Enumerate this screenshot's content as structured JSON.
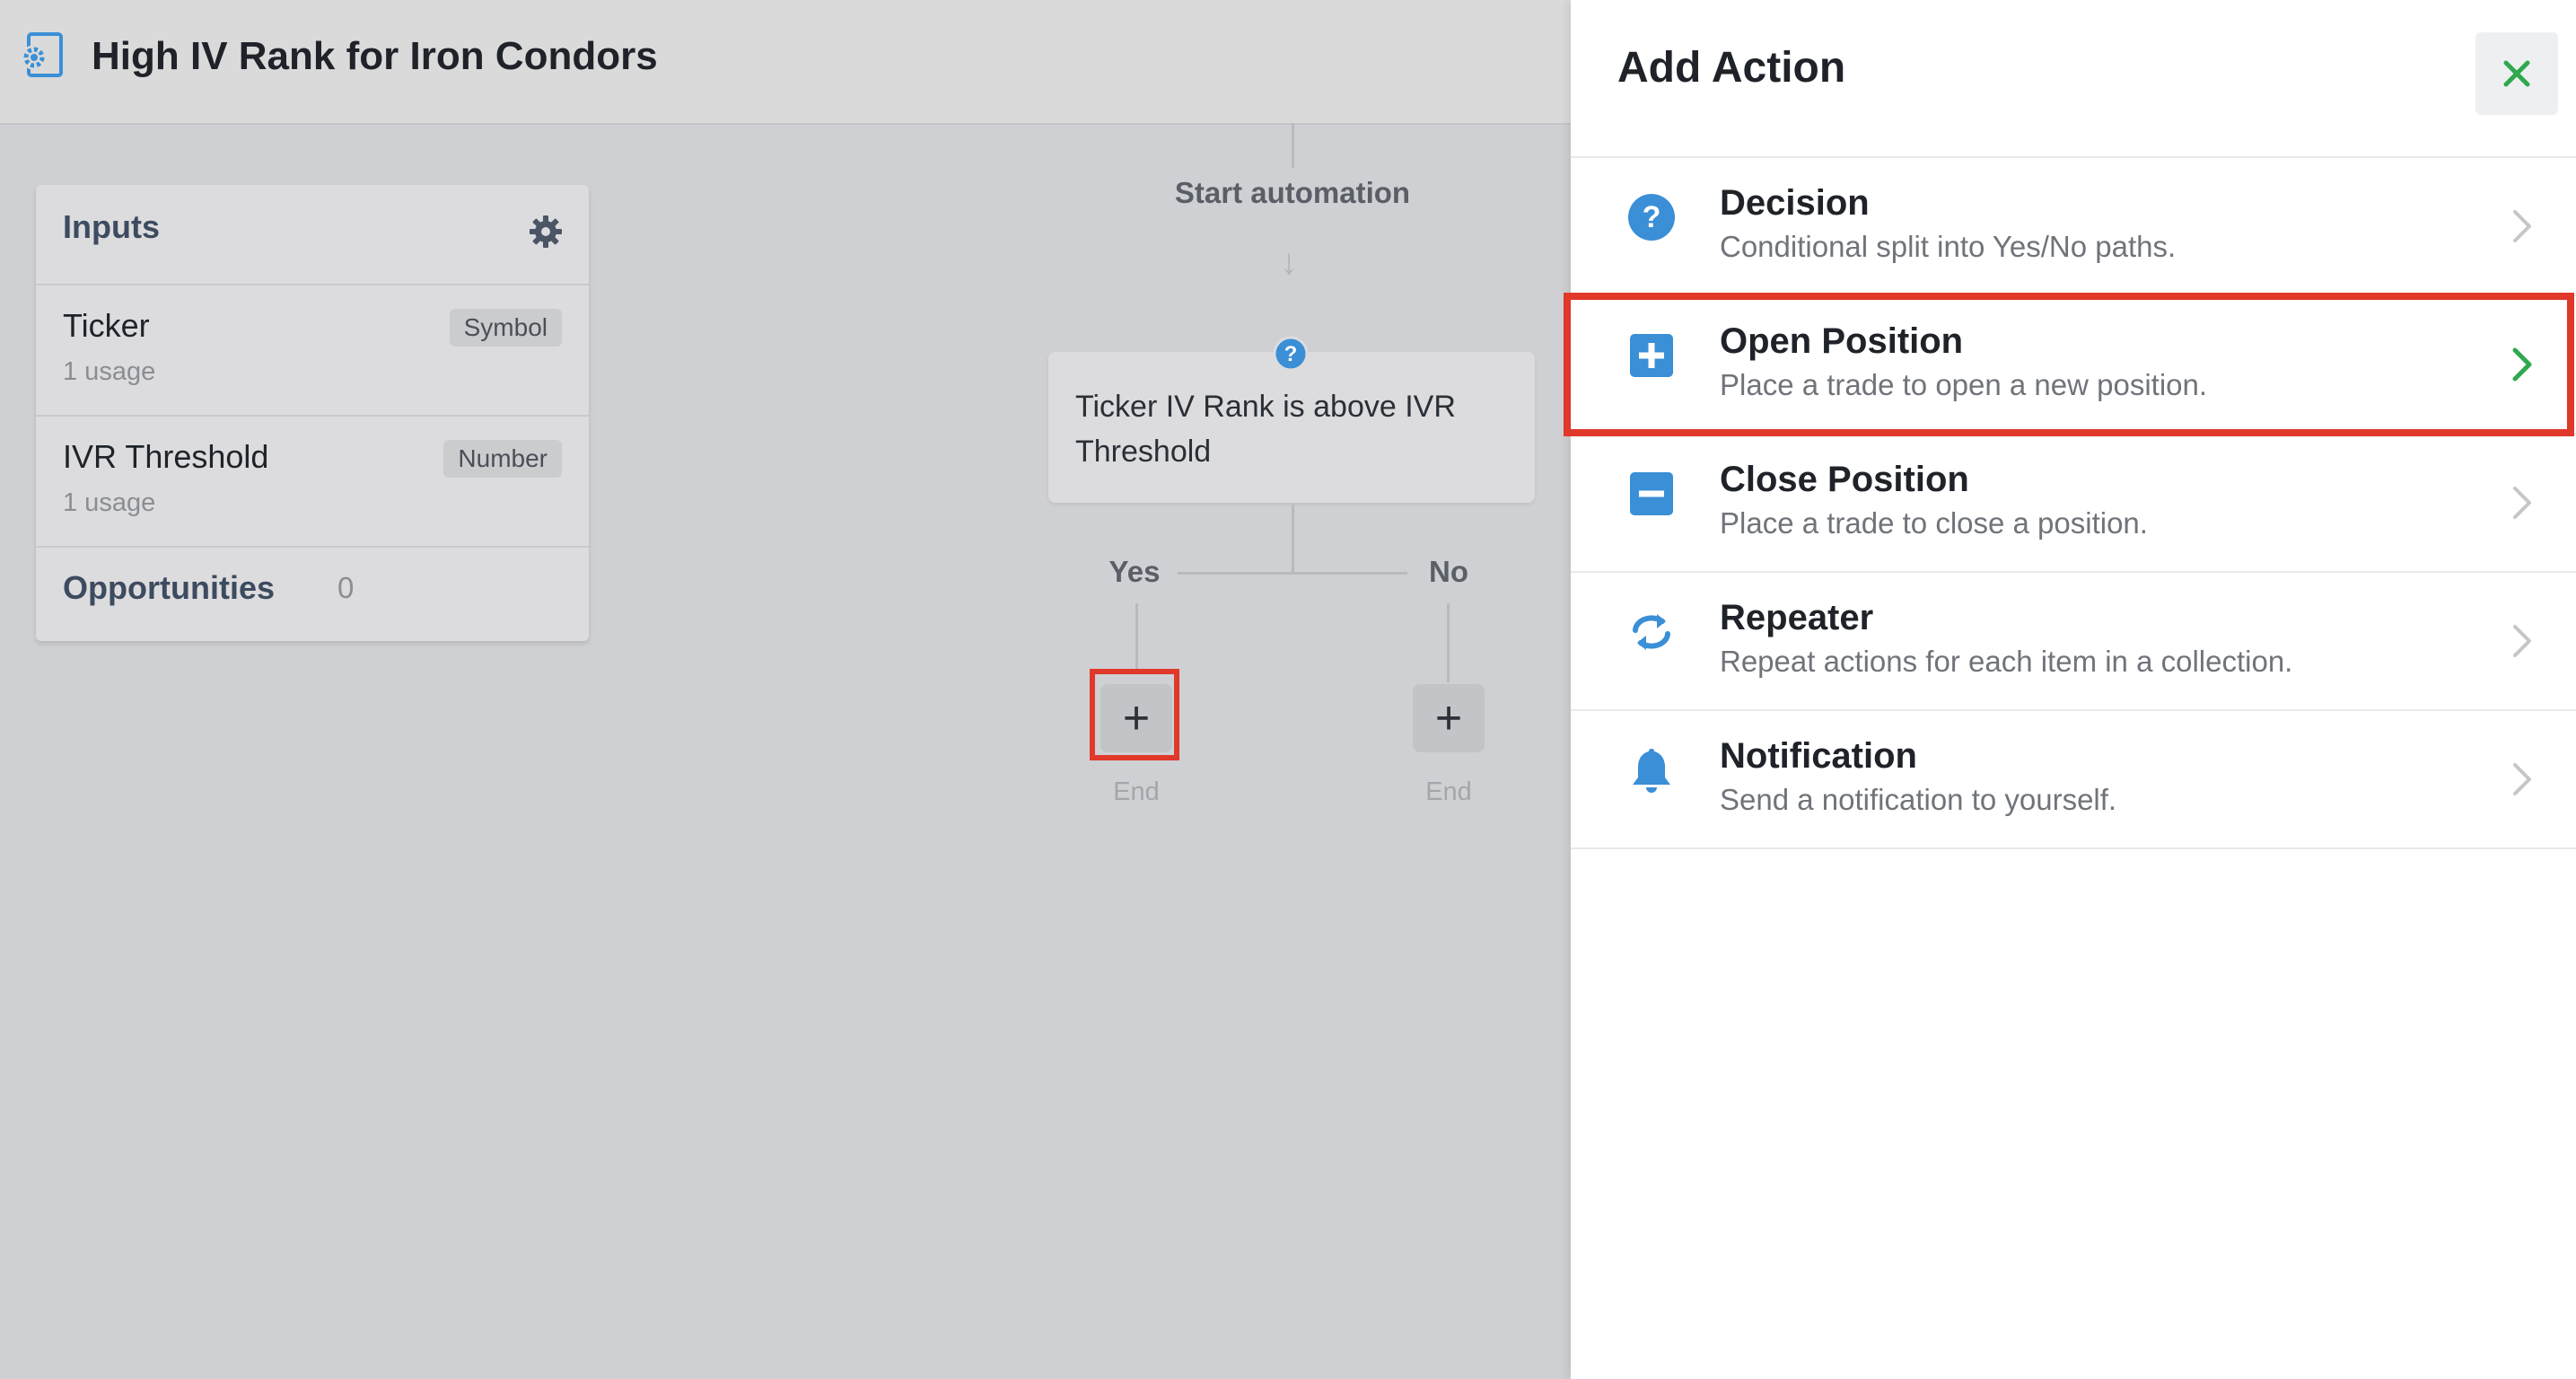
{
  "header": {
    "title": "High IV Rank for Iron Condors",
    "icon": "automation-gear-icon"
  },
  "inputs": {
    "title": "Inputs",
    "settings_icon": "gear-icon",
    "rows": [
      {
        "name": "Ticker",
        "usage": "1 usage",
        "type": "Symbol"
      },
      {
        "name": "IVR Threshold",
        "usage": "1 usage",
        "type": "Number"
      }
    ],
    "opportunities_label": "Opportunities",
    "opportunities_count": "0"
  },
  "flow": {
    "start_label": "Start automation",
    "decision_text": "Ticker IV Rank is above IVR Threshold",
    "yes_label": "Yes",
    "no_label": "No",
    "add_symbol": "+",
    "end_label": "End"
  },
  "drawer": {
    "title": "Add Action",
    "close_icon": "close-icon",
    "actions": [
      {
        "title": "Decision",
        "desc": "Conditional split into Yes/No paths.",
        "icon": "question-circle-icon"
      },
      {
        "title": "Open Position",
        "desc": "Place a trade to open a new position.",
        "icon": "plus-square-icon"
      },
      {
        "title": "Close Position",
        "desc": "Place a trade to close a position.",
        "icon": "minus-square-icon"
      },
      {
        "title": "Repeater",
        "desc": "Repeat actions for each item in a collection.",
        "icon": "repeat-icon"
      },
      {
        "title": "Notification",
        "desc": "Send a notification to yourself.",
        "icon": "bell-icon"
      }
    ]
  },
  "colors": {
    "accent_blue": "#3a8fd6",
    "highlight_red": "#e0382a",
    "chevron_green": "#2fa84f",
    "close_green": "#2fa84f"
  }
}
